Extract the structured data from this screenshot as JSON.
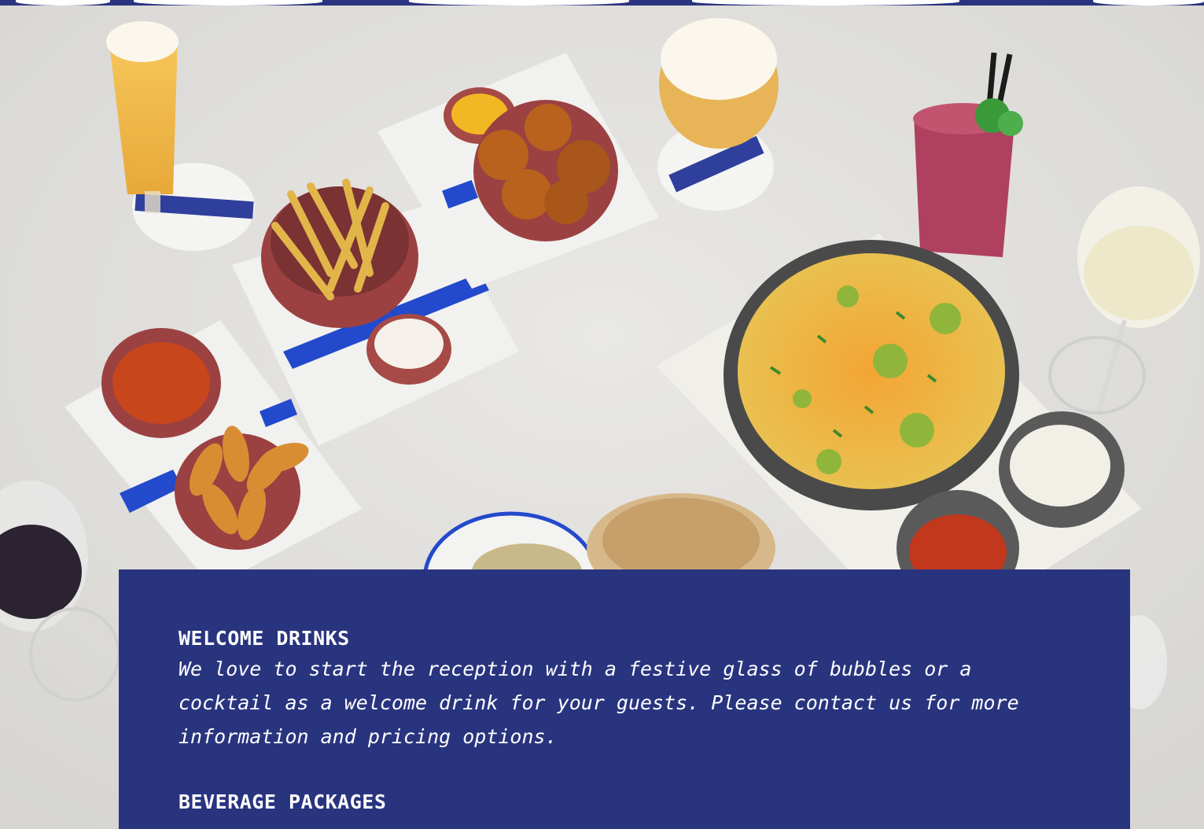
{
  "hero": {
    "image_name": "food-and-drinks-photo",
    "icons": [
      "beer-glass-icon",
      "cocktail-glass-icon",
      "wine-glass-icon",
      "fries-bowl-icon",
      "croquettes-bowl-icon",
      "nachos-bowl-icon",
      "shrimp-bowl-icon",
      "sauce-bowl-icon",
      "dim-sum-basket-icon"
    ]
  },
  "colors": {
    "panel_bg": "#29347f",
    "panel_text": "#ffffff",
    "table_bg": "#e4e3e0",
    "accent_blue": "#1f3fc8"
  },
  "sections": [
    {
      "heading": "WELCOME DRINKS",
      "body": "We love to start the reception with a festive glass of bubbles or a cocktail as a welcome drink for your guests. Please contact us for more information and pricing options."
    },
    {
      "heading": "BEVERAGE PACKAGES"
    }
  ]
}
